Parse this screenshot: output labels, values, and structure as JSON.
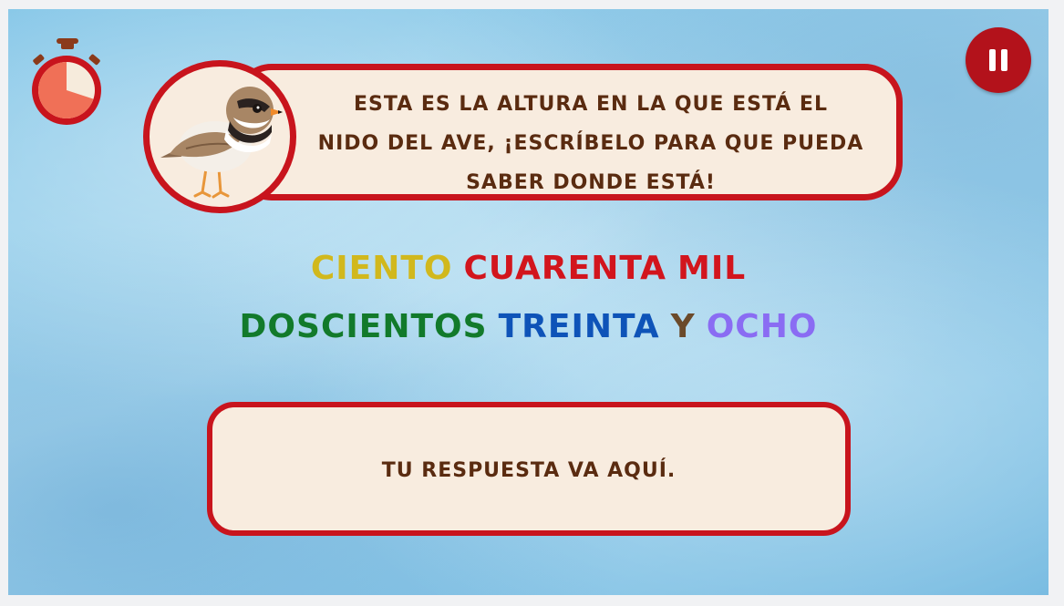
{
  "prompt": {
    "line1": "Esta es la altura en la que está el",
    "line2": "nido del ave, ¡escríbelo para que pueda",
    "line3": "saber donde está!"
  },
  "number_words": {
    "line1": [
      {
        "text": "Ciento",
        "color": "#d1b81d"
      },
      {
        "text": "cuarenta",
        "color": "#d2151d"
      },
      {
        "text": "mil",
        "color": "#d2151d"
      }
    ],
    "line2": [
      {
        "text": "doscientos",
        "color": "#127a2b"
      },
      {
        "text": "treinta",
        "color": "#0e53b8"
      },
      {
        "text": "y",
        "color": "#6b4a2a"
      },
      {
        "text": "ocho",
        "color": "#8a6cf3"
      }
    ]
  },
  "answer": {
    "placeholder": "Tu respuesta va aquí."
  },
  "timer": {
    "remaining_fraction": 0.7
  },
  "icons": {
    "timer": "stopwatch-icon",
    "pause": "pause-icon",
    "bird": "plover-bird-icon"
  },
  "colors": {
    "accent": "#c8141d",
    "panel": "#f8ecdf",
    "text": "#5a2b10"
  }
}
